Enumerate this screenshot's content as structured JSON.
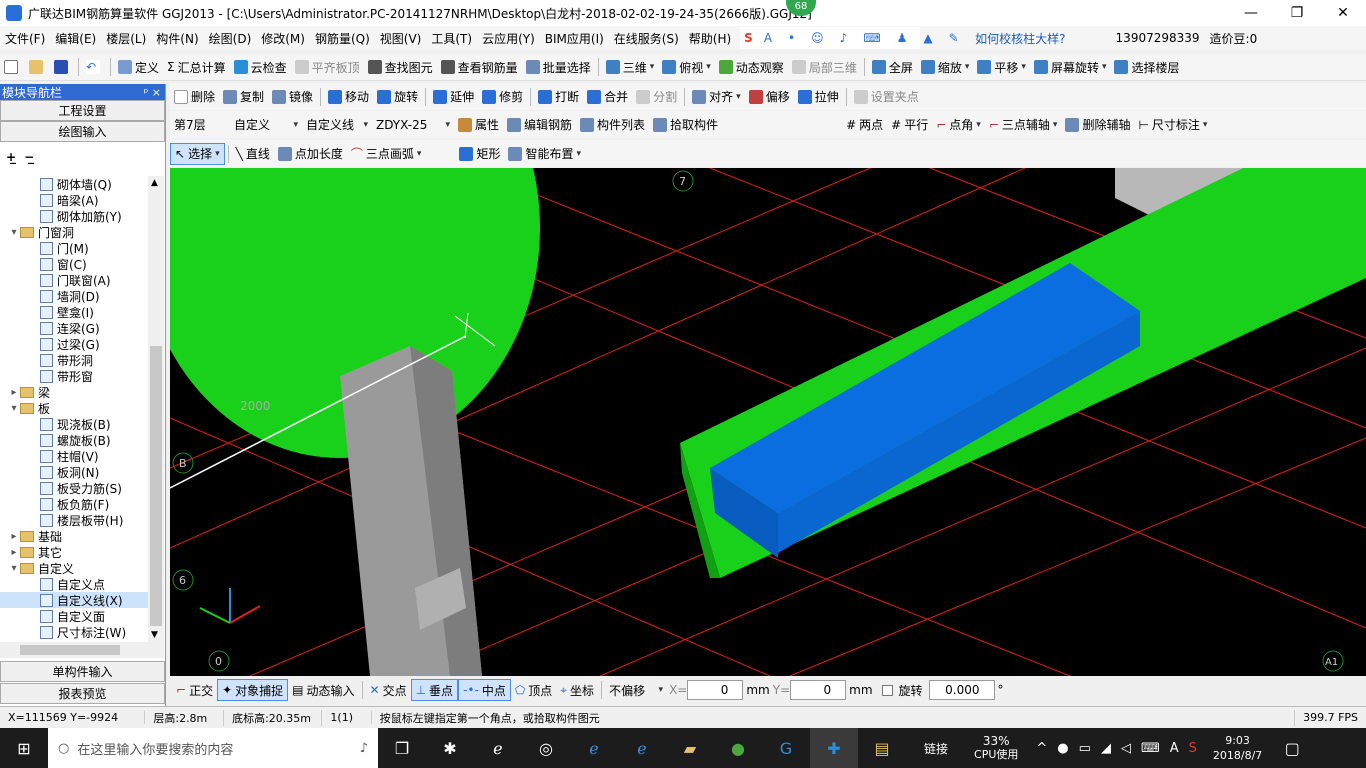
{
  "window": {
    "title": "广联达BIM钢筋算量软件 GGJ2013 - [C:\\Users\\Administrator.PC-20141127NRHM\\Desktop\\白龙村-2018-02-02-19-24-35(2666版).GGJ12]",
    "badge": "68",
    "min": "—",
    "restore": "❐",
    "close": "✕"
  },
  "menu": [
    "文件(F)",
    "编辑(E)",
    "楼层(L)",
    "构件(N)",
    "绘图(D)",
    "修改(M)",
    "钢筋量(Q)",
    "视图(V)",
    "工具(T)",
    "云应用(Y)",
    "BIM应用(I)",
    "在线服务(S)",
    "帮助(H)"
  ],
  "menu_right": {
    "help_link": "如何校核柱大样?",
    "phone": "13907298339",
    "price": "造价豆:0"
  },
  "toolbar1": [
    "定义",
    "汇总计算",
    "云检查",
    "平齐板顶",
    "查找图元",
    "查看钢筋量",
    "批量选择",
    "三维",
    "俯视",
    "动态观察",
    "局部三维",
    "全屏",
    "缩放",
    "平移",
    "屏幕旋转",
    "选择楼层"
  ],
  "toolbar2": [
    "删除",
    "复制",
    "镜像",
    "移动",
    "旋转",
    "延伸",
    "修剪",
    "打断",
    "合并",
    "分割",
    "对齐",
    "偏移",
    "拉伸",
    "设置夹点"
  ],
  "toolbar3": {
    "floor": "第7层",
    "type": "自定义",
    "line": "自定义线",
    "code": "ZDYX-25",
    "items": [
      "属性",
      "编辑钢筋",
      "构件列表",
      "拾取构件"
    ],
    "right": [
      "两点",
      "平行",
      "点角",
      "三点辅轴",
      "删除辅轴",
      "尺寸标注"
    ]
  },
  "toolbar4": [
    "选择",
    "直线",
    "点加长度",
    "三点画弧",
    "矩形",
    "智能布置"
  ],
  "left_panel": {
    "header": "模块导航栏",
    "pin": "ᵖ ×",
    "btn1": "工程设置",
    "btn2": "绘图输入",
    "btn3": "单构件输入",
    "btn4": "报表预览",
    "tree": [
      {
        "t": "砌体墙(Q)",
        "lvl": 2,
        "k": "item"
      },
      {
        "t": "暗梁(A)",
        "lvl": 2,
        "k": "item"
      },
      {
        "t": "砌体加筋(Y)",
        "lvl": 2,
        "k": "item"
      },
      {
        "t": "门窗洞",
        "lvl": 1,
        "k": "folder",
        "e": "▾"
      },
      {
        "t": "门(M)",
        "lvl": 2,
        "k": "item"
      },
      {
        "t": "窗(C)",
        "lvl": 2,
        "k": "item"
      },
      {
        "t": "门联窗(A)",
        "lvl": 2,
        "k": "item"
      },
      {
        "t": "墙洞(D)",
        "lvl": 2,
        "k": "item"
      },
      {
        "t": "壁龛(I)",
        "lvl": 2,
        "k": "item"
      },
      {
        "t": "连梁(G)",
        "lvl": 2,
        "k": "item"
      },
      {
        "t": "过梁(G)",
        "lvl": 2,
        "k": "item"
      },
      {
        "t": "带形洞",
        "lvl": 2,
        "k": "item"
      },
      {
        "t": "带形窗",
        "lvl": 2,
        "k": "item"
      },
      {
        "t": "梁",
        "lvl": 1,
        "k": "folder",
        "e": "▸"
      },
      {
        "t": "板",
        "lvl": 1,
        "k": "folder",
        "e": "▾"
      },
      {
        "t": "现浇板(B)",
        "lvl": 2,
        "k": "item"
      },
      {
        "t": "螺旋板(B)",
        "lvl": 2,
        "k": "item"
      },
      {
        "t": "柱帽(V)",
        "lvl": 2,
        "k": "item"
      },
      {
        "t": "板洞(N)",
        "lvl": 2,
        "k": "item"
      },
      {
        "t": "板受力筋(S)",
        "lvl": 2,
        "k": "item"
      },
      {
        "t": "板负筋(F)",
        "lvl": 2,
        "k": "item"
      },
      {
        "t": "楼层板带(H)",
        "lvl": 2,
        "k": "item"
      },
      {
        "t": "基础",
        "lvl": 1,
        "k": "folder",
        "e": "▸"
      },
      {
        "t": "其它",
        "lvl": 1,
        "k": "folder",
        "e": "▸"
      },
      {
        "t": "自定义",
        "lvl": 1,
        "k": "folder",
        "e": "▾"
      },
      {
        "t": "自定义点",
        "lvl": 2,
        "k": "item"
      },
      {
        "t": "自定义线(X)",
        "lvl": 2,
        "k": "item",
        "sel": true
      },
      {
        "t": "自定义面",
        "lvl": 2,
        "k": "item"
      },
      {
        "t": "尺寸标注(W)",
        "lvl": 2,
        "k": "item"
      }
    ]
  },
  "canvas": {
    "dim": "2000",
    "axes": {
      "a": "7",
      "b": "B",
      "c": "6",
      "d": "0",
      "e": "A1"
    },
    "colors": {
      "green": "#19d11a",
      "blue": "#0a6ee0",
      "grey": "#9a9a9a",
      "grid": "#e02020"
    }
  },
  "snap": {
    "items": [
      "正交",
      "对象捕捉",
      "动态输入",
      "交点",
      "垂点",
      "中点",
      "顶点",
      "坐标"
    ],
    "offset": "不偏移",
    "x_label": "X=",
    "x": "0",
    "y_label": "Y=",
    "y": "0",
    "unit": "mm",
    "rotate": "旋转",
    "rot_val": "0.000",
    "deg": "°"
  },
  "status": {
    "coords": "X=111569 Y=-9924",
    "floor_h": "层高:2.8m",
    "base_h": "底标高:20.35m",
    "count": "1(1)",
    "hint": "按鼠标左键指定第一个角点，或拾取构件图元",
    "fps": "399.7 FPS"
  },
  "taskbar": {
    "search": "在这里输入你要搜索的内容",
    "link": "链接",
    "cpu": "33%",
    "cpu_label": "CPU使用",
    "time": "9:03",
    "date": "2018/8/7",
    "ime": "A"
  }
}
